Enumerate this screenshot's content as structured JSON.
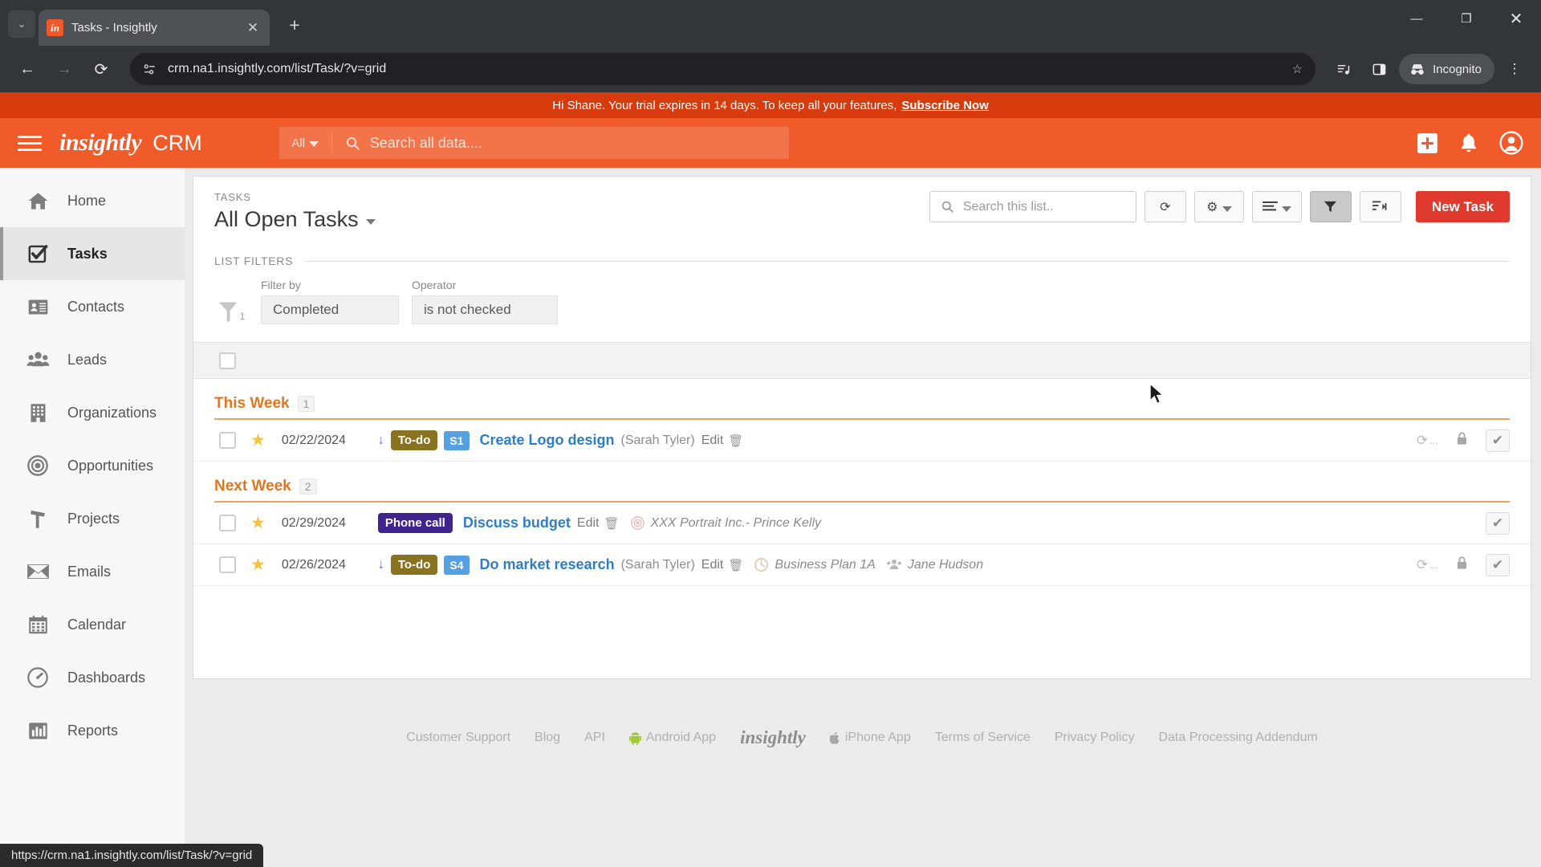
{
  "browser": {
    "tab": {
      "title": "Tasks - Insightly",
      "favicon_text": "in",
      "close_label": "✕"
    },
    "new_tab_label": "+",
    "tab_search_label": "⌄",
    "window_controls": {
      "minimize": "—",
      "maximize": "❐",
      "close": "✕"
    },
    "nav": {
      "back": "←",
      "forward": "→",
      "reload": "⟳"
    },
    "omnibox": {
      "url": "crm.na1.insightly.com/list/Task/?v=grid",
      "site_info_icon": "page-info-icon"
    },
    "actions": {
      "bookmark": "☆",
      "media": "media-icon",
      "sidepanel": "panel-icon",
      "menu": "⋮"
    },
    "incognito_label": "Incognito",
    "status_url": "https://crm.na1.insightly.com/list/Task/?v=grid"
  },
  "trial": {
    "message": "Hi Shane. Your trial expires in 14 days. To keep all your features,",
    "cta": "Subscribe Now"
  },
  "header": {
    "logo": "insightly",
    "product": "CRM",
    "search": {
      "scope": "All",
      "placeholder": "Search all data...."
    },
    "icons": {
      "add": "+",
      "notifications": "bell-icon",
      "account": "account-icon"
    }
  },
  "sidebar": {
    "items": [
      {
        "label": "Home",
        "icon": "home-icon",
        "active": false
      },
      {
        "label": "Tasks",
        "icon": "tasks-icon",
        "active": true
      },
      {
        "label": "Contacts",
        "icon": "contacts-icon",
        "active": false
      },
      {
        "label": "Leads",
        "icon": "leads-icon",
        "active": false
      },
      {
        "label": "Organizations",
        "icon": "organizations-icon",
        "active": false
      },
      {
        "label": "Opportunities",
        "icon": "opportunities-icon",
        "active": false
      },
      {
        "label": "Projects",
        "icon": "projects-icon",
        "active": false
      },
      {
        "label": "Emails",
        "icon": "emails-icon",
        "active": false
      },
      {
        "label": "Calendar",
        "icon": "calendar-icon",
        "active": false
      },
      {
        "label": "Dashboards",
        "icon": "dashboards-icon",
        "active": false
      },
      {
        "label": "Reports",
        "icon": "reports-icon",
        "active": false
      }
    ]
  },
  "list": {
    "eyebrow": "TASKS",
    "title": "All Open Tasks",
    "search_placeholder": "Search this list..",
    "toolbar": {
      "refresh": "⟳",
      "settings": "⚙",
      "view": "view-list-icon",
      "filter": "filter-icon",
      "sort": "sort-icon",
      "new_task": "New Task"
    },
    "filters": {
      "legend": "LIST FILTERS",
      "count": "1",
      "filter_by_label": "Filter by",
      "filter_by_value": "Completed",
      "operator_label": "Operator",
      "operator_value": "is not checked"
    },
    "groups": [
      {
        "name": "This Week",
        "count": "1",
        "rows": [
          {
            "date": "02/22/2024",
            "has_priority_arrow": true,
            "category": "To-do",
            "category_type": "todo",
            "stage": "S1",
            "title": "Create Logo design",
            "owner": "(Sarah Tyler)",
            "edit": "Edit",
            "related": "",
            "related_icon": "",
            "assignee": "",
            "assignee_icon": "",
            "recurring": true,
            "locked": true
          }
        ]
      },
      {
        "name": "Next Week",
        "count": "2",
        "rows": [
          {
            "date": "02/29/2024",
            "has_priority_arrow": false,
            "category": "Phone call",
            "category_type": "phone",
            "stage": "",
            "title": "Discuss budget",
            "owner": "",
            "edit": "Edit",
            "related": "XXX Portrait Inc.- Prince Kelly",
            "related_icon": "opportunity-icon",
            "assignee": "",
            "assignee_icon": "",
            "recurring": false,
            "locked": false
          },
          {
            "date": "02/26/2024",
            "has_priority_arrow": true,
            "category": "To-do",
            "category_type": "todo",
            "stage": "S4",
            "title": "Do market research",
            "owner": "(Sarah Tyler)",
            "edit": "Edit",
            "related": "Business Plan 1A",
            "related_icon": "project-icon",
            "assignee": "Jane Hudson",
            "assignee_icon": "contact-icon",
            "recurring": true,
            "locked": true
          }
        ]
      }
    ]
  },
  "footer": {
    "links": [
      "Customer Support",
      "Blog",
      "API",
      "Android App",
      "iPhone App",
      "Terms of Service",
      "Privacy Policy",
      "Data Processing Addendum"
    ],
    "brand": "insightly"
  }
}
